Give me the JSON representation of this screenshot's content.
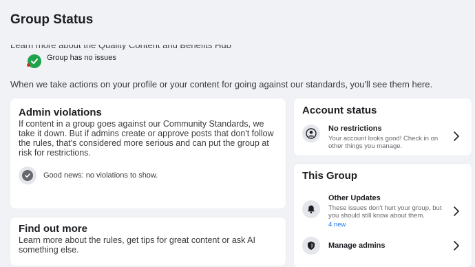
{
  "page": {
    "title": "Group Status",
    "cutoff_line": "Learn more about the Quality Content and Benefits Hub",
    "status_text": "Group has no issues",
    "intro": "When we take actions on your profile or your content for going against our standards, you'll see them here."
  },
  "admin_violations": {
    "title": "Admin violations",
    "description": "If content in a group goes against our Community Standards, we take it down. But if admins create or approve posts that don't follow the rules, that's considered more serious and can put the group at risk for restrictions.",
    "good_news": "Good news: no violations to show."
  },
  "find_out_more": {
    "title": "Find out more",
    "description": "Learn more about the rules, get tips for great content or ask AI something else."
  },
  "account_status": {
    "title": "Account status",
    "item": {
      "title": "No restrictions",
      "description": "Your account looks good! Check in on other things you manage.",
      "icon": "user-circle-icon"
    }
  },
  "this_group": {
    "title": "This Group",
    "items": [
      {
        "title": "Other Updates",
        "description": "These issues don't hurt your group, but you should still know about them.",
        "badge": "4 new",
        "icon": "bell-icon"
      },
      {
        "title": "Manage admins",
        "icon": "shield-icon"
      }
    ]
  },
  "colors": {
    "background": "#f0f2f5",
    "card": "#ffffff",
    "success_green": "#1fa24a",
    "link_blue": "#1877f2",
    "secondary_text": "#65676b"
  }
}
